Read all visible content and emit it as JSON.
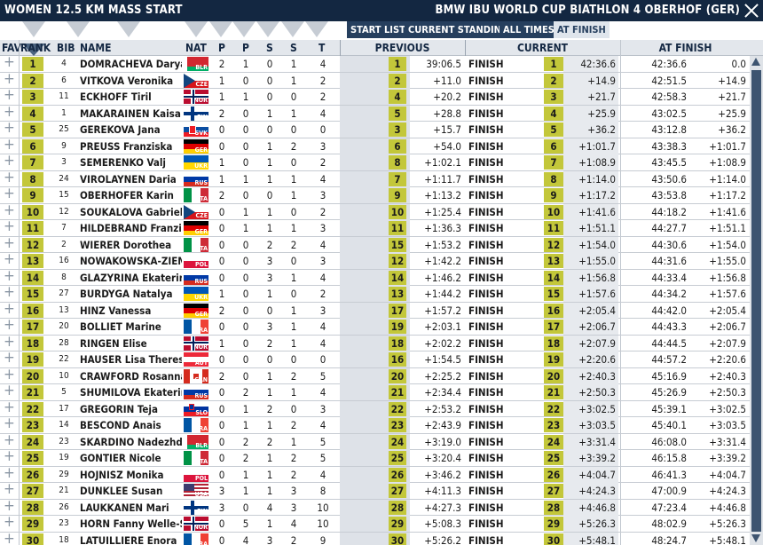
{
  "title": {
    "left": "WOMEN 12.5 KM MASS START",
    "right": "BMW IBU WORLD CUP BIATHLON 4 OBERHOF (GER)"
  },
  "toolbar": {
    "start_list": "START LIST",
    "current_standing": "CURRENT STANDING",
    "all_times": "ALL TIMES",
    "at_finish": "AT FINISH"
  },
  "headers": {
    "fav": "FAV",
    "rank": "RANK",
    "bib": "BIB",
    "name": "NAME",
    "nat": "NAT",
    "p1": "P",
    "p2": "P",
    "s1": "S",
    "s2": "S",
    "t": "T",
    "previous": "PREVIOUS",
    "current": "CURRENT",
    "at_finish": "AT FINISH"
  },
  "icons": {
    "fav": "plus-icon",
    "close": "close-icon",
    "sort": "sort-triangle-icon"
  },
  "colors": {
    "titlebar": "#132741",
    "rank_badge": "#c3c73a",
    "button": "#263f5e"
  },
  "rows": [
    {
      "rank": "1",
      "bib": "4",
      "name": "DOMRACHEVA Darya",
      "nat": "BLR",
      "p1": "2",
      "p2": "1",
      "s1": "0",
      "s2": "1",
      "t": "4",
      "prev_rank": "1",
      "prev_time": "39:06.5",
      "status": "FINISH",
      "cur_rank": "1",
      "cur_time": "42:36.6",
      "at_time": "42:36.6",
      "at_diff": "0.0"
    },
    {
      "rank": "2",
      "bib": "6",
      "name": "VITKOVA Veronika",
      "nat": "CZE",
      "p1": "1",
      "p2": "0",
      "s1": "0",
      "s2": "1",
      "t": "2",
      "prev_rank": "2",
      "prev_time": "+11.0",
      "status": "FINISH",
      "cur_rank": "2",
      "cur_time": "+14.9",
      "at_time": "42:51.5",
      "at_diff": "+14.9"
    },
    {
      "rank": "3",
      "bib": "11",
      "name": "ECKHOFF Tiril",
      "nat": "NOR",
      "p1": "1",
      "p2": "1",
      "s1": "0",
      "s2": "0",
      "t": "2",
      "prev_rank": "4",
      "prev_time": "+20.2",
      "status": "FINISH",
      "cur_rank": "3",
      "cur_time": "+21.7",
      "at_time": "42:58.3",
      "at_diff": "+21.7"
    },
    {
      "rank": "4",
      "bib": "1",
      "name": "MAKARAINEN Kaisa",
      "nat": "FIN",
      "p1": "2",
      "p2": "0",
      "s1": "1",
      "s2": "1",
      "t": "4",
      "prev_rank": "5",
      "prev_time": "+28.8",
      "status": "FINISH",
      "cur_rank": "4",
      "cur_time": "+25.9",
      "at_time": "43:02.5",
      "at_diff": "+25.9"
    },
    {
      "rank": "5",
      "bib": "25",
      "name": "GEREKOVA Jana",
      "nat": "SVK",
      "p1": "0",
      "p2": "0",
      "s1": "0",
      "s2": "0",
      "t": "0",
      "prev_rank": "3",
      "prev_time": "+15.7",
      "status": "FINISH",
      "cur_rank": "5",
      "cur_time": "+36.2",
      "at_time": "43:12.8",
      "at_diff": "+36.2"
    },
    {
      "rank": "6",
      "bib": "9",
      "name": "PREUSS Franziska",
      "nat": "GER",
      "p1": "0",
      "p2": "0",
      "s1": "1",
      "s2": "2",
      "t": "3",
      "prev_rank": "6",
      "prev_time": "+54.0",
      "status": "FINISH",
      "cur_rank": "6",
      "cur_time": "+1:01.7",
      "at_time": "43:38.3",
      "at_diff": "+1:01.7"
    },
    {
      "rank": "7",
      "bib": "3",
      "name": "SEMERENKO Valj",
      "nat": "UKR",
      "p1": "1",
      "p2": "0",
      "s1": "1",
      "s2": "0",
      "t": "2",
      "prev_rank": "8",
      "prev_time": "+1:02.1",
      "status": "FINISH",
      "cur_rank": "7",
      "cur_time": "+1:08.9",
      "at_time": "43:45.5",
      "at_diff": "+1:08.9"
    },
    {
      "rank": "8",
      "bib": "24",
      "name": "VIROLAYNEN Daria",
      "nat": "RUS",
      "p1": "1",
      "p2": "1",
      "s1": "1",
      "s2": "1",
      "t": "4",
      "prev_rank": "7",
      "prev_time": "+1:11.7",
      "status": "FINISH",
      "cur_rank": "8",
      "cur_time": "+1:14.0",
      "at_time": "43:50.6",
      "at_diff": "+1:14.0"
    },
    {
      "rank": "9",
      "bib": "15",
      "name": "OBERHOFER Karin",
      "nat": "ITA",
      "p1": "2",
      "p2": "0",
      "s1": "0",
      "s2": "1",
      "t": "3",
      "prev_rank": "9",
      "prev_time": "+1:13.2",
      "status": "FINISH",
      "cur_rank": "9",
      "cur_time": "+1:17.2",
      "at_time": "43:53.8",
      "at_diff": "+1:17.2"
    },
    {
      "rank": "10",
      "bib": "12",
      "name": "SOUKALOVA Gabriela",
      "nat": "CZE",
      "p1": "0",
      "p2": "1",
      "s1": "1",
      "s2": "0",
      "t": "2",
      "prev_rank": "10",
      "prev_time": "+1:25.4",
      "status": "FINISH",
      "cur_rank": "10",
      "cur_time": "+1:41.6",
      "at_time": "44:18.2",
      "at_diff": "+1:41.6"
    },
    {
      "rank": "11",
      "bib": "7",
      "name": "HILDEBRAND Franziska",
      "nat": "GER",
      "p1": "0",
      "p2": "1",
      "s1": "1",
      "s2": "1",
      "t": "3",
      "prev_rank": "11",
      "prev_time": "+1:36.3",
      "status": "FINISH",
      "cur_rank": "11",
      "cur_time": "+1:51.1",
      "at_time": "44:27.7",
      "at_diff": "+1:51.1"
    },
    {
      "rank": "12",
      "bib": "2",
      "name": "WIERER Dorothea",
      "nat": "ITA",
      "p1": "0",
      "p2": "0",
      "s1": "2",
      "s2": "2",
      "t": "4",
      "prev_rank": "15",
      "prev_time": "+1:53.2",
      "status": "FINISH",
      "cur_rank": "12",
      "cur_time": "+1:54.0",
      "at_time": "44:30.6",
      "at_diff": "+1:54.0"
    },
    {
      "rank": "13",
      "bib": "16",
      "name": "NOWAKOWSKA-ZIEMNIAK Weronika",
      "nat": "POL",
      "p1": "0",
      "p2": "0",
      "s1": "3",
      "s2": "0",
      "t": "3",
      "prev_rank": "12",
      "prev_time": "+1:42.2",
      "status": "FINISH",
      "cur_rank": "13",
      "cur_time": "+1:55.0",
      "at_time": "44:31.6",
      "at_diff": "+1:55.0"
    },
    {
      "rank": "14",
      "bib": "8",
      "name": "GLAZYRINA Ekaterina",
      "nat": "RUS",
      "p1": "0",
      "p2": "0",
      "s1": "3",
      "s2": "1",
      "t": "4",
      "prev_rank": "14",
      "prev_time": "+1:46.2",
      "status": "FINISH",
      "cur_rank": "14",
      "cur_time": "+1:56.8",
      "at_time": "44:33.4",
      "at_diff": "+1:56.8"
    },
    {
      "rank": "15",
      "bib": "27",
      "name": "BURDYGA Natalya",
      "nat": "UKR",
      "p1": "1",
      "p2": "0",
      "s1": "1",
      "s2": "0",
      "t": "2",
      "prev_rank": "13",
      "prev_time": "+1:44.2",
      "status": "FINISH",
      "cur_rank": "15",
      "cur_time": "+1:57.6",
      "at_time": "44:34.2",
      "at_diff": "+1:57.6"
    },
    {
      "rank": "16",
      "bib": "13",
      "name": "HINZ Vanessa",
      "nat": "GER",
      "p1": "2",
      "p2": "0",
      "s1": "0",
      "s2": "1",
      "t": "3",
      "prev_rank": "17",
      "prev_time": "+1:57.2",
      "status": "FINISH",
      "cur_rank": "16",
      "cur_time": "+2:05.4",
      "at_time": "44:42.0",
      "at_diff": "+2:05.4"
    },
    {
      "rank": "17",
      "bib": "20",
      "name": "BOLLIET Marine",
      "nat": "FRA",
      "p1": "0",
      "p2": "0",
      "s1": "3",
      "s2": "1",
      "t": "4",
      "prev_rank": "19",
      "prev_time": "+2:03.1",
      "status": "FINISH",
      "cur_rank": "17",
      "cur_time": "+2:06.7",
      "at_time": "44:43.3",
      "at_diff": "+2:06.7"
    },
    {
      "rank": "18",
      "bib": "28",
      "name": "RINGEN Elise",
      "nat": "NOR",
      "p1": "1",
      "p2": "0",
      "s1": "2",
      "s2": "1",
      "t": "4",
      "prev_rank": "18",
      "prev_time": "+2:02.2",
      "status": "FINISH",
      "cur_rank": "18",
      "cur_time": "+2:07.9",
      "at_time": "44:44.5",
      "at_diff": "+2:07.9"
    },
    {
      "rank": "19",
      "bib": "22",
      "name": "HAUSER Lisa Theresa",
      "nat": "AUT",
      "p1": "0",
      "p2": "0",
      "s1": "0",
      "s2": "0",
      "t": "0",
      "prev_rank": "16",
      "prev_time": "+1:54.5",
      "status": "FINISH",
      "cur_rank": "19",
      "cur_time": "+2:20.6",
      "at_time": "44:57.2",
      "at_diff": "+2:20.6"
    },
    {
      "rank": "20",
      "bib": "10",
      "name": "CRAWFORD Rosanna",
      "nat": "CAN",
      "p1": "2",
      "p2": "0",
      "s1": "1",
      "s2": "2",
      "t": "5",
      "prev_rank": "20",
      "prev_time": "+2:25.2",
      "status": "FINISH",
      "cur_rank": "20",
      "cur_time": "+2:40.3",
      "at_time": "45:16.9",
      "at_diff": "+2:40.3"
    },
    {
      "rank": "21",
      "bib": "5",
      "name": "SHUMILOVA Ekaterina",
      "nat": "RUS",
      "p1": "0",
      "p2": "2",
      "s1": "1",
      "s2": "1",
      "t": "4",
      "prev_rank": "21",
      "prev_time": "+2:34.4",
      "status": "FINISH",
      "cur_rank": "21",
      "cur_time": "+2:50.3",
      "at_time": "45:26.9",
      "at_diff": "+2:50.3"
    },
    {
      "rank": "22",
      "bib": "17",
      "name": "GREGORIN Teja",
      "nat": "SLO",
      "p1": "0",
      "p2": "1",
      "s1": "2",
      "s2": "0",
      "t": "3",
      "prev_rank": "22",
      "prev_time": "+2:53.2",
      "status": "FINISH",
      "cur_rank": "22",
      "cur_time": "+3:02.5",
      "at_time": "45:39.1",
      "at_diff": "+3:02.5"
    },
    {
      "rank": "23",
      "bib": "14",
      "name": "BESCOND Anais",
      "nat": "FRA",
      "p1": "0",
      "p2": "1",
      "s1": "1",
      "s2": "2",
      "t": "4",
      "prev_rank": "23",
      "prev_time": "+2:43.9",
      "status": "FINISH",
      "cur_rank": "23",
      "cur_time": "+3:03.5",
      "at_time": "45:40.1",
      "at_diff": "+3:03.5"
    },
    {
      "rank": "24",
      "bib": "23",
      "name": "SKARDINO Nadezhda",
      "nat": "BLR",
      "p1": "0",
      "p2": "2",
      "s1": "2",
      "s2": "1",
      "t": "5",
      "prev_rank": "24",
      "prev_time": "+3:19.0",
      "status": "FINISH",
      "cur_rank": "24",
      "cur_time": "+3:31.4",
      "at_time": "46:08.0",
      "at_diff": "+3:31.4"
    },
    {
      "rank": "25",
      "bib": "19",
      "name": "GONTIER Nicole",
      "nat": "ITA",
      "p1": "0",
      "p2": "2",
      "s1": "1",
      "s2": "2",
      "t": "5",
      "prev_rank": "25",
      "prev_time": "+3:20.4",
      "status": "FINISH",
      "cur_rank": "25",
      "cur_time": "+3:39.2",
      "at_time": "46:15.8",
      "at_diff": "+3:39.2"
    },
    {
      "rank": "26",
      "bib": "29",
      "name": "HOJNISZ Monika",
      "nat": "POL",
      "p1": "0",
      "p2": "1",
      "s1": "1",
      "s2": "2",
      "t": "4",
      "prev_rank": "26",
      "prev_time": "+3:46.2",
      "status": "FINISH",
      "cur_rank": "26",
      "cur_time": "+4:04.7",
      "at_time": "46:41.3",
      "at_diff": "+4:04.7"
    },
    {
      "rank": "27",
      "bib": "21",
      "name": "DUNKLEE Susan",
      "nat": "USA",
      "p1": "3",
      "p2": "1",
      "s1": "1",
      "s2": "3",
      "t": "8",
      "prev_rank": "27",
      "prev_time": "+4:11.3",
      "status": "FINISH",
      "cur_rank": "27",
      "cur_time": "+4:24.3",
      "at_time": "47:00.9",
      "at_diff": "+4:24.3"
    },
    {
      "rank": "28",
      "bib": "26",
      "name": "LAUKKANEN Mari",
      "nat": "FIN",
      "p1": "3",
      "p2": "0",
      "s1": "4",
      "s2": "3",
      "t": "10",
      "prev_rank": "28",
      "prev_time": "+4:27.3",
      "status": "FINISH",
      "cur_rank": "28",
      "cur_time": "+4:46.8",
      "at_time": "47:23.4",
      "at_diff": "+4:46.8"
    },
    {
      "rank": "29",
      "bib": "23",
      "name": "HORN Fanny Welle-Strand",
      "nat": "NOR",
      "p1": "0",
      "p2": "5",
      "s1": "1",
      "s2": "4",
      "t": "10",
      "prev_rank": "29",
      "prev_time": "+5:08.3",
      "status": "FINISH",
      "cur_rank": "29",
      "cur_time": "+5:26.3",
      "at_time": "48:02.9",
      "at_diff": "+5:26.3"
    },
    {
      "rank": "30",
      "bib": "18",
      "name": "LATUILLIERE Enora",
      "nat": "FRA",
      "p1": "0",
      "p2": "4",
      "s1": "3",
      "s2": "2",
      "t": "9",
      "prev_rank": "30",
      "prev_time": "+5:26.2",
      "status": "FINISH",
      "cur_rank": "30",
      "cur_time": "+5:48.1",
      "at_time": "48:24.7",
      "at_diff": "+5:48.1"
    }
  ]
}
